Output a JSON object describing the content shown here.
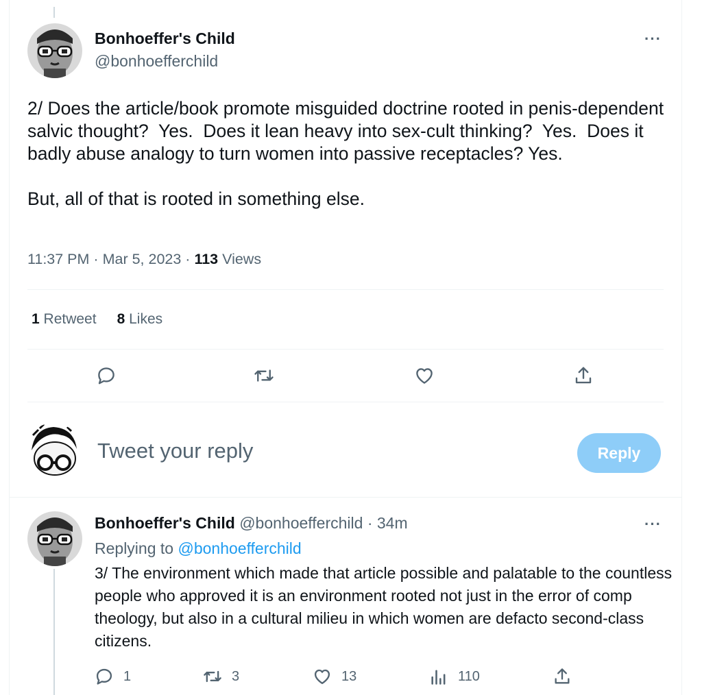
{
  "main_tweet": {
    "author_name": "Bonhoeffer's Child",
    "author_handle": "@bonhoefferchild",
    "text": "2/ Does the article/book promote misguided doctrine rooted in penis-dependent salvic thought?  Yes.  Does it lean heavy into sex-cult thinking?  Yes.  Does it badly abuse analogy to turn women into passive receptacles? Yes.\n\nBut, all of that is rooted in something else.",
    "time": "11:37 PM",
    "separator": "·",
    "date": "Mar 5, 2023",
    "views_count": "113",
    "views_label": "Views",
    "retweets_count": "1",
    "retweets_label": "Retweet",
    "likes_count": "8",
    "likes_label": "Likes",
    "more_glyph": "···"
  },
  "reply_box": {
    "placeholder": "Tweet your reply",
    "button_label": "Reply"
  },
  "reply_tweet": {
    "author_name": "Bonhoeffer's Child",
    "author_handle": "@bonhoefferchild",
    "separator": "·",
    "age": "34m",
    "replying_prefix": "Replying to",
    "replying_handle": "@bonhoefferchild",
    "text": "3/ The environment which made that article possible and palatable to the countless people who approved it is an environment rooted not just in the error of comp theology, but also in a cultural milieu in which women are defacto second-class citizens.",
    "replies": "1",
    "retweets": "3",
    "likes": "13",
    "views": "110",
    "more_glyph": "···"
  },
  "icons": [
    "reply-icon",
    "retweet-icon",
    "like-icon",
    "share-icon",
    "views-icon",
    "more-icon"
  ],
  "colors": {
    "text": "#0f1419",
    "secondary": "#536471",
    "link": "#1d9bf0",
    "reply_button_disabled": "#8ecdf8",
    "divider": "#eff3f4"
  }
}
